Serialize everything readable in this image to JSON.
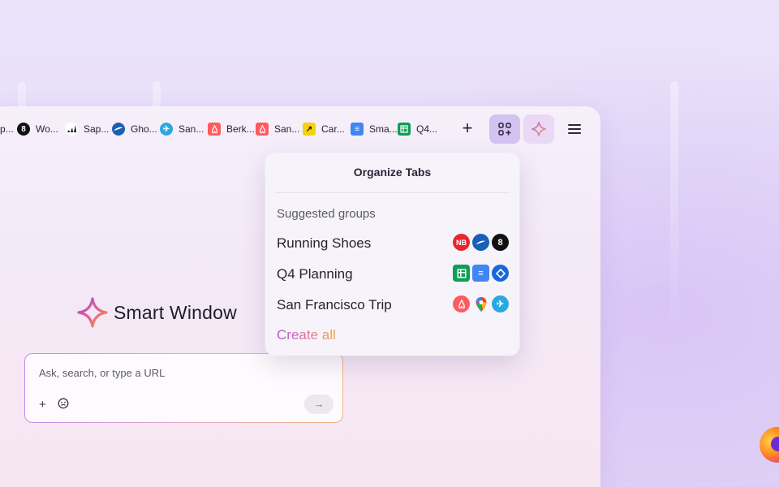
{
  "tabs": [
    {
      "label": "p...",
      "icon": "partial-icon",
      "color": "#2a2a2a"
    },
    {
      "label": "Wo...",
      "icon": "oura-icon",
      "color": "#111111"
    },
    {
      "label": "Sap...",
      "icon": "adidas-icon",
      "color": "#ffffff"
    },
    {
      "label": "Gho...",
      "icon": "brooks-icon",
      "color": "#1a5fb4"
    },
    {
      "label": "San...",
      "icon": "airplane-icon",
      "color": "#2aa8e0"
    },
    {
      "label": "Berk...",
      "icon": "airbnb-icon",
      "color": "#ff5a5f"
    },
    {
      "label": "San...",
      "icon": "airbnb-icon",
      "color": "#ff5a5f"
    },
    {
      "label": "Car...",
      "icon": "arrow-icon",
      "color": "#f5d20e"
    },
    {
      "label": "Sma...",
      "icon": "docs-icon",
      "color": "#4285f4"
    },
    {
      "label": "Q4...",
      "icon": "sheets-icon",
      "color": "#0f9d58"
    }
  ],
  "brand": {
    "title": "Smart Window"
  },
  "search": {
    "placeholder": "Ask, search, or type a URL"
  },
  "popup": {
    "title": "Organize Tabs",
    "subhead": "Suggested groups",
    "groups": [
      {
        "label": "Running Shoes",
        "icons": [
          "new-balance-icon",
          "brooks-icon",
          "oura-icon"
        ]
      },
      {
        "label": "Q4 Planning",
        "icons": [
          "sheets-icon",
          "docs-icon",
          "jira-icon"
        ]
      },
      {
        "label": "San Francisco Trip",
        "icons": [
          "airbnb-icon",
          "maps-icon",
          "airplane-icon"
        ]
      }
    ],
    "create_all": "Create all"
  },
  "colors": {
    "accent": "#d4c3f1",
    "gradient_start": "#b354d8",
    "gradient_end": "#f2a541"
  }
}
